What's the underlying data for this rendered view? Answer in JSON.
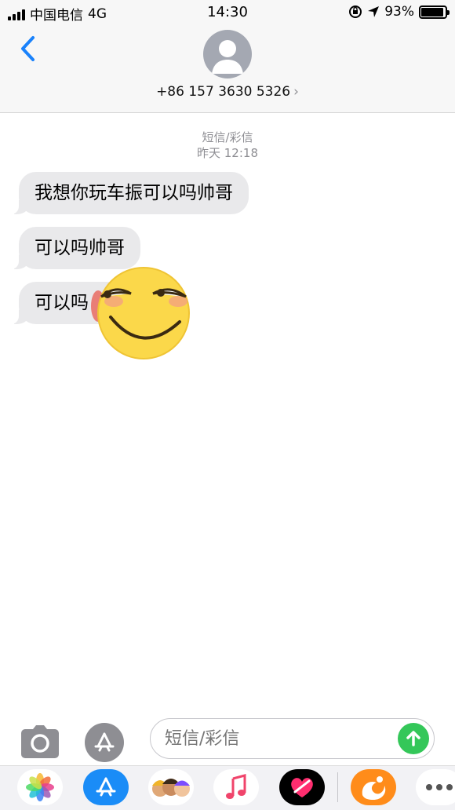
{
  "status_bar": {
    "carrier": "中国电信",
    "network": "4G",
    "time": "14:30",
    "battery_percent_label": "93%",
    "battery_level": 0.93
  },
  "header": {
    "back_icon": "chevron-left-icon",
    "avatar_icon": "person-silhouette-icon",
    "contact": "+86 157 3630 5326",
    "chevron": "›"
  },
  "conversation": {
    "service": "短信/彩信",
    "timestamp": "昨天 12:18",
    "messages": [
      {
        "text": "我想你玩车振可以吗帅哥"
      },
      {
        "text": "可以吗帅哥"
      },
      {
        "text": "可以吗"
      }
    ],
    "sticker": "sly-smile-emoji"
  },
  "input_bar": {
    "camera_icon": "camera-icon",
    "app_store_icon": "app-store-icon",
    "placeholder": "短信/彩信",
    "send_icon": "arrow-up-icon"
  },
  "app_drawer": {
    "apps": [
      "photos-icon",
      "app-store-icon",
      "memoji-icon",
      "music-icon",
      "digital-touch-icon",
      "uc-browser-icon",
      "more-icon"
    ]
  },
  "colors": {
    "accent_blue": "#1a82fb",
    "bubble_gray": "#e9e9eb",
    "send_green": "#34c759"
  }
}
